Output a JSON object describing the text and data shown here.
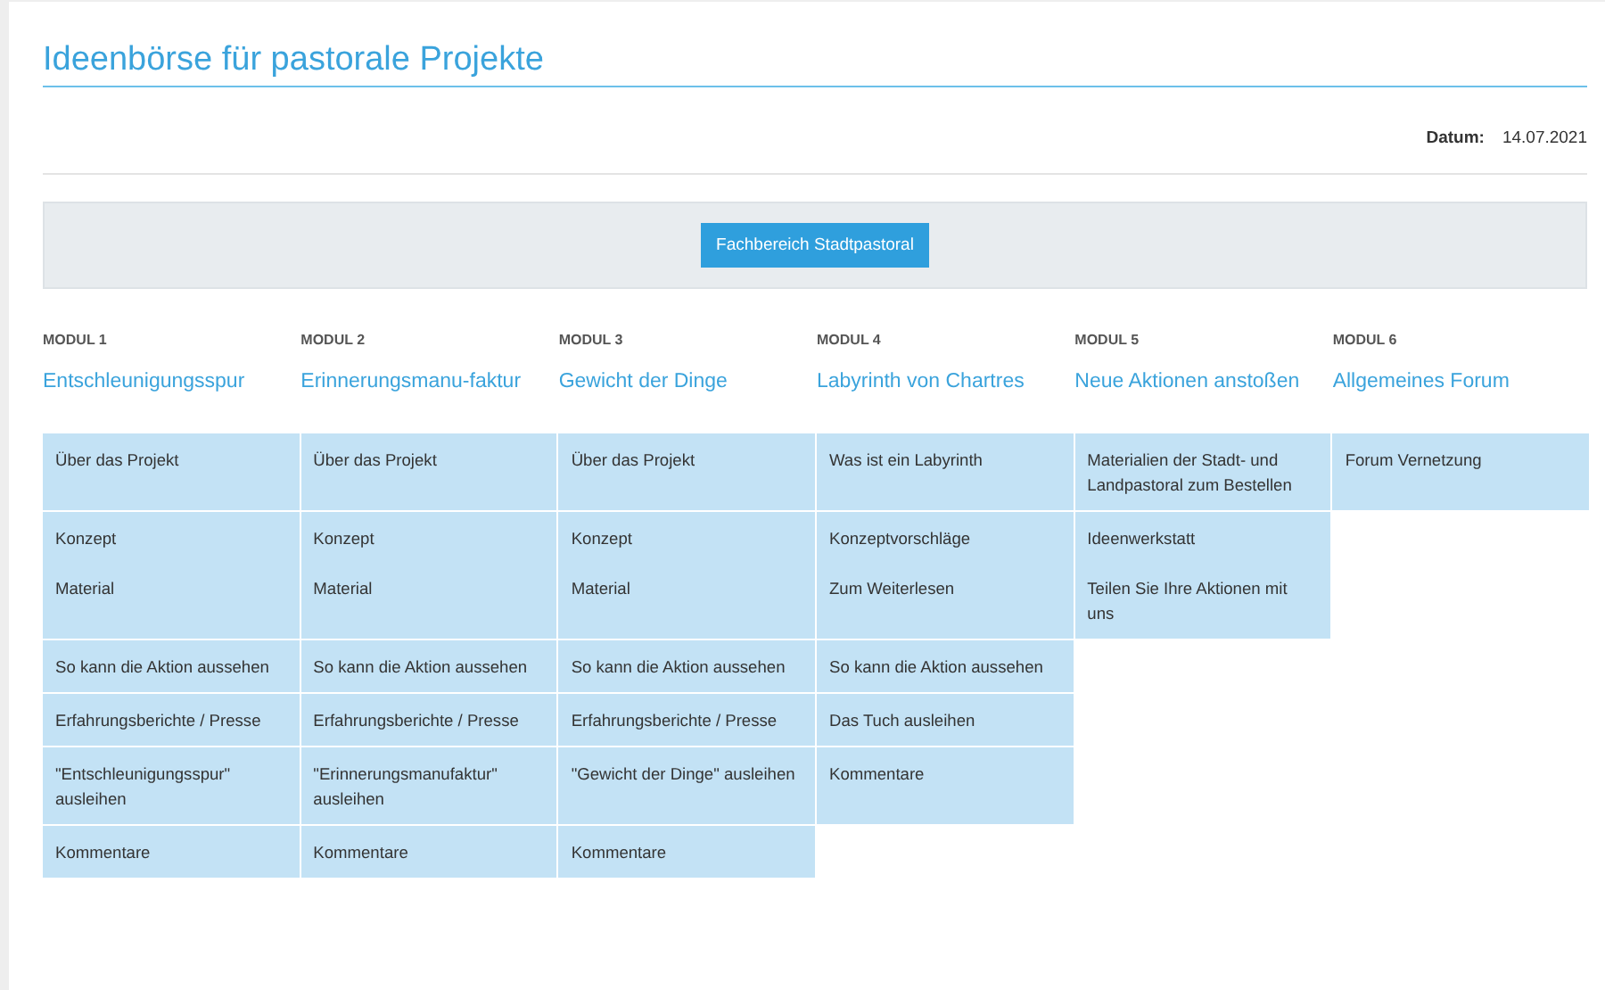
{
  "page_title": "Ideenbörse für pastorale Projekte",
  "date": {
    "label": "Datum:",
    "value": "14.07.2021"
  },
  "filter_button": "Fachbereich Stadtpastoral",
  "modules": [
    {
      "label": "MODUL 1",
      "title": "Entschleunigungsspur",
      "cells": [
        [
          "Über das Projekt"
        ],
        [
          "Konzept",
          "Material"
        ],
        [
          "So kann die Aktion aussehen"
        ],
        [
          "Erfahrungsberichte / Presse"
        ],
        [
          "\"Entschleunigungsspur\" ausleihen"
        ],
        [
          "Kommentare"
        ]
      ]
    },
    {
      "label": "MODUL 2",
      "title": "Erinnerungsmanu-faktur",
      "cells": [
        [
          "Über das Projekt"
        ],
        [
          "Konzept",
          "Material"
        ],
        [
          "So kann die Aktion aussehen"
        ],
        [
          "Erfahrungsberichte / Presse"
        ],
        [
          "\"Erinnerungsmanufaktur\" ausleihen"
        ],
        [
          "Kommentare"
        ]
      ]
    },
    {
      "label": "MODUL 3",
      "title": "Gewicht der Dinge",
      "cells": [
        [
          "Über das Projekt"
        ],
        [
          "Konzept",
          "Material"
        ],
        [
          "So kann die Aktion aussehen"
        ],
        [
          "Erfahrungsberichte / Presse"
        ],
        [
          "\"Gewicht der Dinge\" ausleihen"
        ],
        [
          "Kommentare"
        ]
      ]
    },
    {
      "label": "MODUL 4",
      "title": "Labyrinth von Chartres",
      "cells": [
        [
          "Was ist ein Labyrinth"
        ],
        [
          "Konzeptvorschläge",
          "Zum Weiterlesen"
        ],
        [
          "So kann die Aktion aussehen"
        ],
        [
          "Das Tuch ausleihen"
        ],
        [
          "Kommentare"
        ]
      ]
    },
    {
      "label": "MODUL 5",
      "title": "Neue Aktionen anstoßen",
      "cells": [
        [
          "Materialien der Stadt- und Landpastoral zum Bestellen"
        ],
        [
          "Ideenwerkstatt",
          "Teilen Sie Ihre Aktionen mit uns"
        ]
      ]
    },
    {
      "label": "MODUL 6",
      "title": "Allgemeines Forum",
      "cells": [
        [
          "Forum Vernetzung"
        ]
      ]
    }
  ]
}
